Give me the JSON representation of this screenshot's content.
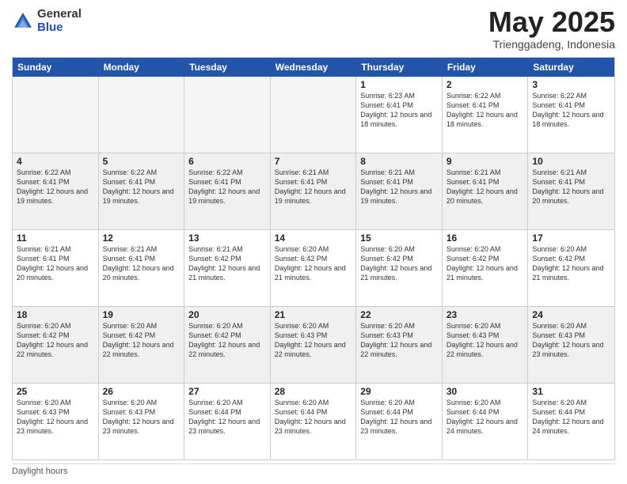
{
  "logo": {
    "general": "General",
    "blue": "Blue"
  },
  "title": "May 2025",
  "location": "Trienggadeng, Indonesia",
  "days_header": [
    "Sunday",
    "Monday",
    "Tuesday",
    "Wednesday",
    "Thursday",
    "Friday",
    "Saturday"
  ],
  "footer": "Daylight hours",
  "weeks": [
    [
      {
        "day": "",
        "empty": true
      },
      {
        "day": "",
        "empty": true
      },
      {
        "day": "",
        "empty": true
      },
      {
        "day": "",
        "empty": true
      },
      {
        "day": "1",
        "sunrise": "Sunrise: 6:23 AM",
        "sunset": "Sunset: 6:41 PM",
        "daylight": "Daylight: 12 hours and 18 minutes."
      },
      {
        "day": "2",
        "sunrise": "Sunrise: 6:22 AM",
        "sunset": "Sunset: 6:41 PM",
        "daylight": "Daylight: 12 hours and 18 minutes."
      },
      {
        "day": "3",
        "sunrise": "Sunrise: 6:22 AM",
        "sunset": "Sunset: 6:41 PM",
        "daylight": "Daylight: 12 hours and 18 minutes."
      }
    ],
    [
      {
        "day": "4",
        "sunrise": "Sunrise: 6:22 AM",
        "sunset": "Sunset: 6:41 PM",
        "daylight": "Daylight: 12 hours and 19 minutes."
      },
      {
        "day": "5",
        "sunrise": "Sunrise: 6:22 AM",
        "sunset": "Sunset: 6:41 PM",
        "daylight": "Daylight: 12 hours and 19 minutes."
      },
      {
        "day": "6",
        "sunrise": "Sunrise: 6:22 AM",
        "sunset": "Sunset: 6:41 PM",
        "daylight": "Daylight: 12 hours and 19 minutes."
      },
      {
        "day": "7",
        "sunrise": "Sunrise: 6:21 AM",
        "sunset": "Sunset: 6:41 PM",
        "daylight": "Daylight: 12 hours and 19 minutes."
      },
      {
        "day": "8",
        "sunrise": "Sunrise: 6:21 AM",
        "sunset": "Sunset: 6:41 PM",
        "daylight": "Daylight: 12 hours and 19 minutes."
      },
      {
        "day": "9",
        "sunrise": "Sunrise: 6:21 AM",
        "sunset": "Sunset: 6:41 PM",
        "daylight": "Daylight: 12 hours and 20 minutes."
      },
      {
        "day": "10",
        "sunrise": "Sunrise: 6:21 AM",
        "sunset": "Sunset: 6:41 PM",
        "daylight": "Daylight: 12 hours and 20 minutes."
      }
    ],
    [
      {
        "day": "11",
        "sunrise": "Sunrise: 6:21 AM",
        "sunset": "Sunset: 6:41 PM",
        "daylight": "Daylight: 12 hours and 20 minutes."
      },
      {
        "day": "12",
        "sunrise": "Sunrise: 6:21 AM",
        "sunset": "Sunset: 6:41 PM",
        "daylight": "Daylight: 12 hours and 20 minutes."
      },
      {
        "day": "13",
        "sunrise": "Sunrise: 6:21 AM",
        "sunset": "Sunset: 6:42 PM",
        "daylight": "Daylight: 12 hours and 21 minutes."
      },
      {
        "day": "14",
        "sunrise": "Sunrise: 6:20 AM",
        "sunset": "Sunset: 6:42 PM",
        "daylight": "Daylight: 12 hours and 21 minutes."
      },
      {
        "day": "15",
        "sunrise": "Sunrise: 6:20 AM",
        "sunset": "Sunset: 6:42 PM",
        "daylight": "Daylight: 12 hours and 21 minutes."
      },
      {
        "day": "16",
        "sunrise": "Sunrise: 6:20 AM",
        "sunset": "Sunset: 6:42 PM",
        "daylight": "Daylight: 12 hours and 21 minutes."
      },
      {
        "day": "17",
        "sunrise": "Sunrise: 6:20 AM",
        "sunset": "Sunset: 6:42 PM",
        "daylight": "Daylight: 12 hours and 21 minutes."
      }
    ],
    [
      {
        "day": "18",
        "sunrise": "Sunrise: 6:20 AM",
        "sunset": "Sunset: 6:42 PM",
        "daylight": "Daylight: 12 hours and 22 minutes."
      },
      {
        "day": "19",
        "sunrise": "Sunrise: 6:20 AM",
        "sunset": "Sunset: 6:42 PM",
        "daylight": "Daylight: 12 hours and 22 minutes."
      },
      {
        "day": "20",
        "sunrise": "Sunrise: 6:20 AM",
        "sunset": "Sunset: 6:42 PM",
        "daylight": "Daylight: 12 hours and 22 minutes."
      },
      {
        "day": "21",
        "sunrise": "Sunrise: 6:20 AM",
        "sunset": "Sunset: 6:43 PM",
        "daylight": "Daylight: 12 hours and 22 minutes."
      },
      {
        "day": "22",
        "sunrise": "Sunrise: 6:20 AM",
        "sunset": "Sunset: 6:43 PM",
        "daylight": "Daylight: 12 hours and 22 minutes."
      },
      {
        "day": "23",
        "sunrise": "Sunrise: 6:20 AM",
        "sunset": "Sunset: 6:43 PM",
        "daylight": "Daylight: 12 hours and 22 minutes."
      },
      {
        "day": "24",
        "sunrise": "Sunrise: 6:20 AM",
        "sunset": "Sunset: 6:43 PM",
        "daylight": "Daylight: 12 hours and 23 minutes."
      }
    ],
    [
      {
        "day": "25",
        "sunrise": "Sunrise: 6:20 AM",
        "sunset": "Sunset: 6:43 PM",
        "daylight": "Daylight: 12 hours and 23 minutes."
      },
      {
        "day": "26",
        "sunrise": "Sunrise: 6:20 AM",
        "sunset": "Sunset: 6:43 PM",
        "daylight": "Daylight: 12 hours and 23 minutes."
      },
      {
        "day": "27",
        "sunrise": "Sunrise: 6:20 AM",
        "sunset": "Sunset: 6:44 PM",
        "daylight": "Daylight: 12 hours and 23 minutes."
      },
      {
        "day": "28",
        "sunrise": "Sunrise: 6:20 AM",
        "sunset": "Sunset: 6:44 PM",
        "daylight": "Daylight: 12 hours and 23 minutes."
      },
      {
        "day": "29",
        "sunrise": "Sunrise: 6:20 AM",
        "sunset": "Sunset: 6:44 PM",
        "daylight": "Daylight: 12 hours and 23 minutes."
      },
      {
        "day": "30",
        "sunrise": "Sunrise: 6:20 AM",
        "sunset": "Sunset: 6:44 PM",
        "daylight": "Daylight: 12 hours and 24 minutes."
      },
      {
        "day": "31",
        "sunrise": "Sunrise: 6:20 AM",
        "sunset": "Sunset: 6:44 PM",
        "daylight": "Daylight: 12 hours and 24 minutes."
      }
    ]
  ]
}
